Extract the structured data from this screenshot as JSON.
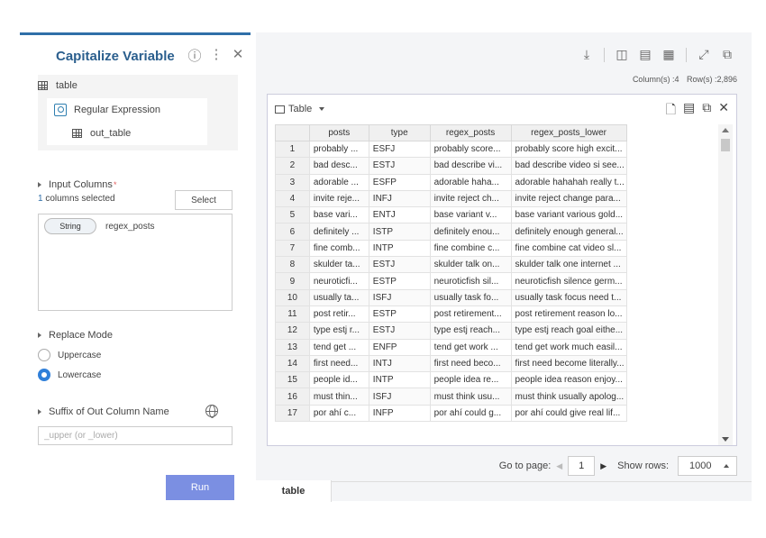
{
  "left_panel": {
    "title": "Capitalize Variable",
    "icons": [
      "help-icon",
      "more-icon",
      "close-icon"
    ],
    "tree": {
      "input_table": "table",
      "operator": "Regular Expression",
      "output_table": "out_table"
    },
    "input_columns": {
      "label": "Input Columns",
      "required_mark": "*",
      "selected_count": "1",
      "selected_suffix": " columns selected",
      "select_button": "Select",
      "columns": [
        {
          "type": "String",
          "name": "regex_posts"
        }
      ]
    },
    "replace_mode": {
      "label": "Replace Mode",
      "options": [
        "Uppercase",
        "Lowercase"
      ],
      "selected": "Lowercase"
    },
    "suffix": {
      "label": "Suffix of Out Column Name",
      "placeholder": "_upper (or _lower)"
    },
    "run_button": "Run"
  },
  "toolbar": {
    "icons": [
      "download-icon",
      "split-vertical-icon",
      "split-horizontal-icon",
      "grid-icon",
      "expand-icon",
      "popout-icon"
    ],
    "columns_label": "Column(s) :4",
    "rows_label": "Row(s) :2,896"
  },
  "table_card": {
    "title": "Table",
    "icons": [
      "export-icon",
      "table-view-icon",
      "copy-icon",
      "close-icon"
    ],
    "headers": [
      "",
      "posts",
      "type",
      "regex_posts",
      "regex_posts_lower"
    ],
    "rows": [
      [
        "1",
        "probably ...",
        "ESFJ",
        "probably score...",
        "probably score high excit..."
      ],
      [
        "2",
        "bad desc...",
        "ESTJ",
        "bad describe vi...",
        "bad describe video si see..."
      ],
      [
        "3",
        "adorable ...",
        "ESFP",
        "adorable haha...",
        "adorable hahahah really t..."
      ],
      [
        "4",
        "invite reje...",
        "INFJ",
        "invite reject ch...",
        "invite reject change para..."
      ],
      [
        "5",
        "base vari...",
        "ENTJ",
        "base variant v...",
        "base variant various gold..."
      ],
      [
        "6",
        "definitely ...",
        "ISTP",
        "definitely enou...",
        "definitely enough general..."
      ],
      [
        "7",
        "fine comb...",
        "INTP",
        "fine combine c...",
        "fine combine cat video sl..."
      ],
      [
        "8",
        "skulder ta...",
        "ESTJ",
        "skulder talk on...",
        "skulder talk one internet ..."
      ],
      [
        "9",
        "neuroticfi...",
        "ESTP",
        "neuroticfish sil...",
        "neuroticfish silence germ..."
      ],
      [
        "10",
        "usually ta...",
        "ISFJ",
        "usually task fo...",
        "usually task focus need t..."
      ],
      [
        "11",
        "post retir...",
        "ESTP",
        "post retirement...",
        "post retirement reason lo..."
      ],
      [
        "12",
        "type estj r...",
        "ESTJ",
        "type estj reach...",
        "type estj reach goal eithe..."
      ],
      [
        "13",
        "tend get ...",
        "ENFP",
        "tend get work ...",
        "tend get work much easil..."
      ],
      [
        "14",
        "first need...",
        "INTJ",
        "first need beco...",
        "first need become literally..."
      ],
      [
        "15",
        "people id...",
        "INTP",
        "people idea re...",
        "people idea reason enjoy..."
      ],
      [
        "16",
        "must thin...",
        "ISFJ",
        "must think usu...",
        "must think usually apolog..."
      ],
      [
        "17",
        "por ahí c...",
        "INFP",
        "por ahí could g...",
        "por ahí could give real lif..."
      ]
    ]
  },
  "pager": {
    "goto_label": "Go to page:",
    "page": "1",
    "show_rows_label": "Show rows:",
    "rows_value": "1000"
  },
  "bottom_tab": "table",
  "colors": {
    "accent": "#2f6fa8",
    "run_button": "#7b8fe2",
    "radio_selected": "#2f7fd9"
  }
}
